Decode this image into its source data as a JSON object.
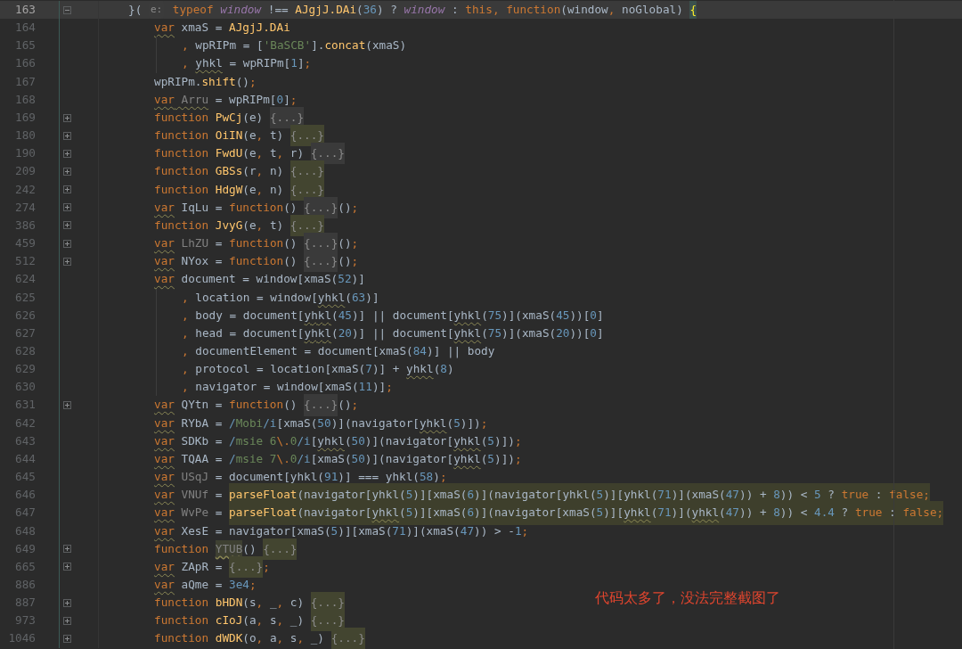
{
  "editor": {
    "lines": [
      {
        "number": "163",
        "kind": "header",
        "current": true,
        "fold": {
          "expanded": true
        },
        "tokens": [
          {
            "kind": "id",
            "text": "}( "
          },
          {
            "kind": "hint",
            "text": "e:"
          },
          {
            "kind": "kw",
            "text": " typeof "
          },
          {
            "kind": "param",
            "text": "window"
          },
          {
            "kind": "id",
            "text": " !== "
          },
          {
            "kind": "fn",
            "text": "AJgjJ.DAi"
          },
          {
            "kind": "id",
            "text": "("
          },
          {
            "kind": "num",
            "text": "36"
          },
          {
            "kind": "id",
            "text": ") ? "
          },
          {
            "kind": "param",
            "text": "window"
          },
          {
            "kind": "id",
            "text": " : "
          },
          {
            "kind": "kw",
            "text": "this"
          },
          {
            "kind": "punc",
            "text": ", "
          },
          {
            "kind": "kw",
            "text": "function"
          },
          {
            "kind": "id",
            "text": "(window"
          },
          {
            "kind": "punc",
            "text": ", "
          },
          {
            "kind": "id",
            "text": "noGlobal) "
          },
          {
            "kind": "brace",
            "text": "{"
          }
        ]
      },
      {
        "number": "164",
        "kind": "statement",
        "current": false,
        "tokens": [
          {
            "kind": "kwu",
            "text": "var"
          },
          {
            "kind": "id",
            "text": " xmaS = "
          },
          {
            "kind": "fn",
            "text": "AJgjJ.DAi"
          }
        ]
      },
      {
        "number": "165",
        "kind": "continuation",
        "current": false,
        "tokens": [
          {
            "kind": "punc",
            "text": ", "
          },
          {
            "kind": "id",
            "text": "wpRIPm = ["
          },
          {
            "kind": "str",
            "text": "'BaSCB'"
          },
          {
            "kind": "id",
            "text": "]."
          },
          {
            "kind": "fn",
            "text": "concat"
          },
          {
            "kind": "id",
            "text": "(xmaS)"
          }
        ]
      },
      {
        "number": "166",
        "kind": "continuation",
        "current": false,
        "tokens": [
          {
            "kind": "punc",
            "text": ", "
          },
          {
            "kind": "idu",
            "text": "yhkl"
          },
          {
            "kind": "id",
            "text": " = wpRIPm["
          },
          {
            "kind": "num",
            "text": "1"
          },
          {
            "kind": "id",
            "text": "]"
          },
          {
            "kind": "punc",
            "text": ";"
          }
        ]
      },
      {
        "number": "167",
        "kind": "statement",
        "current": false,
        "tokens": [
          {
            "kind": "id",
            "text": "wpRIPm."
          },
          {
            "kind": "fn",
            "text": "shift"
          },
          {
            "kind": "id",
            "text": "()"
          },
          {
            "kind": "punc",
            "text": ";"
          }
        ]
      },
      {
        "number": "168",
        "kind": "statement",
        "current": false,
        "tokens": [
          {
            "kind": "kwu",
            "text": "var"
          },
          {
            "kind": "dimu",
            "text": " Arru"
          },
          {
            "kind": "id",
            "text": " = wpRIPm["
          },
          {
            "kind": "num",
            "text": "0"
          },
          {
            "kind": "id",
            "text": "]"
          },
          {
            "kind": "punc",
            "text": ";"
          }
        ]
      },
      {
        "number": "169",
        "kind": "statement",
        "current": false,
        "fold": {
          "expanded": false
        },
        "tokens": [
          {
            "kind": "kw",
            "text": "function "
          },
          {
            "kind": "fn",
            "text": "PwCj"
          },
          {
            "kind": "id",
            "text": "(e) "
          },
          {
            "kind": "fold",
            "text": "{...}"
          }
        ]
      },
      {
        "number": "180",
        "kind": "statement",
        "current": false,
        "fold": {
          "expanded": false
        },
        "tokens": [
          {
            "kind": "kw",
            "text": "function "
          },
          {
            "kind": "fn",
            "text": "OiIN"
          },
          {
            "kind": "id",
            "text": "(e"
          },
          {
            "kind": "punc",
            "text": ", "
          },
          {
            "kind": "id",
            "text": "t) "
          },
          {
            "kind": "foldhl",
            "text": "{...}"
          }
        ]
      },
      {
        "number": "190",
        "kind": "statement",
        "current": false,
        "fold": {
          "expanded": false
        },
        "tokens": [
          {
            "kind": "kw",
            "text": "function "
          },
          {
            "kind": "fn",
            "text": "FwdU"
          },
          {
            "kind": "id",
            "text": "(e"
          },
          {
            "kind": "punc",
            "text": ", "
          },
          {
            "kind": "id",
            "text": "t"
          },
          {
            "kind": "punc",
            "text": ", "
          },
          {
            "kind": "id",
            "text": "r) "
          },
          {
            "kind": "fold",
            "text": "{...}"
          }
        ]
      },
      {
        "number": "209",
        "kind": "statement",
        "current": false,
        "fold": {
          "expanded": false
        },
        "tokens": [
          {
            "kind": "kw",
            "text": "function "
          },
          {
            "kind": "fn",
            "text": "GBSs"
          },
          {
            "kind": "id",
            "text": "(r"
          },
          {
            "kind": "punc",
            "text": ", "
          },
          {
            "kind": "id",
            "text": "n) "
          },
          {
            "kind": "foldhl",
            "text": "{...}"
          }
        ]
      },
      {
        "number": "242",
        "kind": "statement",
        "current": false,
        "fold": {
          "expanded": false
        },
        "tokens": [
          {
            "kind": "kw",
            "text": "function "
          },
          {
            "kind": "fn",
            "text": "HdgW"
          },
          {
            "kind": "id",
            "text": "(e"
          },
          {
            "kind": "punc",
            "text": ", "
          },
          {
            "kind": "id",
            "text": "n) "
          },
          {
            "kind": "foldhl",
            "text": "{...}"
          }
        ]
      },
      {
        "number": "274",
        "kind": "statement",
        "current": false,
        "fold": {
          "expanded": false
        },
        "tokens": [
          {
            "kind": "kwu",
            "text": "var"
          },
          {
            "kind": "id",
            "text": " IqLu = "
          },
          {
            "kind": "kw",
            "text": "function"
          },
          {
            "kind": "id",
            "text": "() "
          },
          {
            "kind": "fold",
            "text": "{...}"
          },
          {
            "kind": "id",
            "text": "()"
          },
          {
            "kind": "punc",
            "text": ";"
          }
        ]
      },
      {
        "number": "386",
        "kind": "statement",
        "current": false,
        "fold": {
          "expanded": false
        },
        "tokens": [
          {
            "kind": "kw",
            "text": "function "
          },
          {
            "kind": "fn",
            "text": "JvyG"
          },
          {
            "kind": "id",
            "text": "(e"
          },
          {
            "kind": "punc",
            "text": ", "
          },
          {
            "kind": "id",
            "text": "t) "
          },
          {
            "kind": "foldhl",
            "text": "{...}"
          }
        ]
      },
      {
        "number": "459",
        "kind": "statement",
        "current": false,
        "fold": {
          "expanded": false
        },
        "tokens": [
          {
            "kind": "kwu",
            "text": "var"
          },
          {
            "kind": "dim",
            "text": " LhZU"
          },
          {
            "kind": "id",
            "text": " = "
          },
          {
            "kind": "kw",
            "text": "function"
          },
          {
            "kind": "id",
            "text": "() "
          },
          {
            "kind": "fold",
            "text": "{...}"
          },
          {
            "kind": "id",
            "text": "()"
          },
          {
            "kind": "punc",
            "text": ";"
          }
        ]
      },
      {
        "number": "512",
        "kind": "statement",
        "current": false,
        "fold": {
          "expanded": false
        },
        "tokens": [
          {
            "kind": "kwu",
            "text": "var"
          },
          {
            "kind": "id",
            "text": " NYox = "
          },
          {
            "kind": "kw",
            "text": "function"
          },
          {
            "kind": "id",
            "text": "() "
          },
          {
            "kind": "fold",
            "text": "{...}"
          },
          {
            "kind": "id",
            "text": "()"
          },
          {
            "kind": "punc",
            "text": ";"
          }
        ]
      },
      {
        "number": "624",
        "kind": "statement",
        "current": false,
        "tokens": [
          {
            "kind": "kwu",
            "text": "var"
          },
          {
            "kind": "id",
            "text": " document = window[xmaS("
          },
          {
            "kind": "num",
            "text": "52"
          },
          {
            "kind": "id",
            "text": ")]"
          }
        ]
      },
      {
        "number": "625",
        "kind": "continuation",
        "current": false,
        "tokens": [
          {
            "kind": "punc",
            "text": ", "
          },
          {
            "kind": "id",
            "text": "location = window["
          },
          {
            "kind": "idu",
            "text": "yhkl"
          },
          {
            "kind": "id",
            "text": "("
          },
          {
            "kind": "num",
            "text": "63"
          },
          {
            "kind": "id",
            "text": ")]"
          }
        ]
      },
      {
        "number": "626",
        "kind": "continuation",
        "current": false,
        "tokens": [
          {
            "kind": "punc",
            "text": ", "
          },
          {
            "kind": "id",
            "text": "body = document["
          },
          {
            "kind": "idu",
            "text": "yhkl"
          },
          {
            "kind": "id",
            "text": "("
          },
          {
            "kind": "num",
            "text": "45"
          },
          {
            "kind": "id",
            "text": ")] || document["
          },
          {
            "kind": "idu",
            "text": "yhkl"
          },
          {
            "kind": "id",
            "text": "("
          },
          {
            "kind": "num",
            "text": "75"
          },
          {
            "kind": "id",
            "text": ")](xmaS("
          },
          {
            "kind": "num",
            "text": "45"
          },
          {
            "kind": "id",
            "text": "))["
          },
          {
            "kind": "num",
            "text": "0"
          },
          {
            "kind": "id",
            "text": "]"
          }
        ]
      },
      {
        "number": "627",
        "kind": "continuation",
        "current": false,
        "tokens": [
          {
            "kind": "punc",
            "text": ", "
          },
          {
            "kind": "id",
            "text": "head = document["
          },
          {
            "kind": "idu",
            "text": "yhkl"
          },
          {
            "kind": "id",
            "text": "("
          },
          {
            "kind": "num",
            "text": "20"
          },
          {
            "kind": "id",
            "text": ")] || document["
          },
          {
            "kind": "idu",
            "text": "yhkl"
          },
          {
            "kind": "id",
            "text": "("
          },
          {
            "kind": "num",
            "text": "75"
          },
          {
            "kind": "id",
            "text": ")](xmaS("
          },
          {
            "kind": "num",
            "text": "20"
          },
          {
            "kind": "id",
            "text": "))["
          },
          {
            "kind": "num",
            "text": "0"
          },
          {
            "kind": "id",
            "text": "]"
          }
        ]
      },
      {
        "number": "628",
        "kind": "continuation",
        "current": false,
        "tokens": [
          {
            "kind": "punc",
            "text": ", "
          },
          {
            "kind": "id",
            "text": "documentElement = document[xmaS("
          },
          {
            "kind": "num",
            "text": "84"
          },
          {
            "kind": "id",
            "text": ")] || body"
          }
        ]
      },
      {
        "number": "629",
        "kind": "continuation",
        "current": false,
        "tokens": [
          {
            "kind": "punc",
            "text": ", "
          },
          {
            "kind": "id",
            "text": "protocol = location[xmaS("
          },
          {
            "kind": "num",
            "text": "7"
          },
          {
            "kind": "id",
            "text": ")] + "
          },
          {
            "kind": "idu",
            "text": "yhkl"
          },
          {
            "kind": "id",
            "text": "("
          },
          {
            "kind": "num",
            "text": "8"
          },
          {
            "kind": "id",
            "text": ")"
          }
        ]
      },
      {
        "number": "630",
        "kind": "continuation",
        "current": false,
        "tokens": [
          {
            "kind": "punc",
            "text": ", "
          },
          {
            "kind": "id",
            "text": "navigator = window[xmaS("
          },
          {
            "kind": "num",
            "text": "11"
          },
          {
            "kind": "id",
            "text": ")]"
          },
          {
            "kind": "punc",
            "text": ";"
          }
        ]
      },
      {
        "number": "631",
        "kind": "statement",
        "current": false,
        "fold": {
          "expanded": false
        },
        "tokens": [
          {
            "kind": "kwu",
            "text": "var"
          },
          {
            "kind": "id",
            "text": " QYtn = "
          },
          {
            "kind": "kw",
            "text": "function"
          },
          {
            "kind": "id",
            "text": "() "
          },
          {
            "kind": "fold",
            "text": "{...}"
          },
          {
            "kind": "id",
            "text": "()"
          },
          {
            "kind": "punc",
            "text": ";"
          }
        ]
      },
      {
        "number": "642",
        "kind": "statement",
        "current": false,
        "tokens": [
          {
            "kind": "kwu",
            "text": "var"
          },
          {
            "kind": "id",
            "text": " RYbA = "
          },
          {
            "kind": "rxd",
            "text": "/"
          },
          {
            "kind": "rx",
            "text": "Mobi"
          },
          {
            "kind": "rxd",
            "text": "/i"
          },
          {
            "kind": "id",
            "text": "[xmaS("
          },
          {
            "kind": "num",
            "text": "50"
          },
          {
            "kind": "id",
            "text": ")](navigator["
          },
          {
            "kind": "idu",
            "text": "yhkl"
          },
          {
            "kind": "id",
            "text": "("
          },
          {
            "kind": "num",
            "text": "5"
          },
          {
            "kind": "id",
            "text": ")])"
          },
          {
            "kind": "punc",
            "text": ";"
          }
        ]
      },
      {
        "number": "643",
        "kind": "statement",
        "current": false,
        "tokens": [
          {
            "kind": "kwu",
            "text": "var"
          },
          {
            "kind": "id",
            "text": " SDKb = "
          },
          {
            "kind": "rxd",
            "text": "/"
          },
          {
            "kind": "rx",
            "text": "msie 6"
          },
          {
            "kind": "esc",
            "text": "\\."
          },
          {
            "kind": "rx",
            "text": "0"
          },
          {
            "kind": "rxd",
            "text": "/i"
          },
          {
            "kind": "id",
            "text": "["
          },
          {
            "kind": "idu",
            "text": "yhkl"
          },
          {
            "kind": "id",
            "text": "("
          },
          {
            "kind": "num",
            "text": "50"
          },
          {
            "kind": "id",
            "text": ")](navigator["
          },
          {
            "kind": "idu",
            "text": "yhkl"
          },
          {
            "kind": "id",
            "text": "("
          },
          {
            "kind": "num",
            "text": "5"
          },
          {
            "kind": "id",
            "text": ")])"
          },
          {
            "kind": "punc",
            "text": ";"
          }
        ]
      },
      {
        "number": "644",
        "kind": "statement",
        "current": false,
        "tokens": [
          {
            "kind": "kwu",
            "text": "var"
          },
          {
            "kind": "id",
            "text": " TQAA = "
          },
          {
            "kind": "rxd",
            "text": "/"
          },
          {
            "kind": "rx",
            "text": "msie 7"
          },
          {
            "kind": "esc",
            "text": "\\."
          },
          {
            "kind": "rx",
            "text": "0"
          },
          {
            "kind": "rxd",
            "text": "/i"
          },
          {
            "kind": "id",
            "text": "[xmaS("
          },
          {
            "kind": "num",
            "text": "50"
          },
          {
            "kind": "id",
            "text": ")](navigator["
          },
          {
            "kind": "idu",
            "text": "yhkl"
          },
          {
            "kind": "id",
            "text": "("
          },
          {
            "kind": "num",
            "text": "5"
          },
          {
            "kind": "id",
            "text": ")])"
          },
          {
            "kind": "punc",
            "text": ";"
          }
        ]
      },
      {
        "number": "645",
        "kind": "statement",
        "current": false,
        "tokens": [
          {
            "kind": "kwu",
            "text": "var"
          },
          {
            "kind": "dim",
            "text": " USqJ"
          },
          {
            "kind": "id",
            "text": " = document["
          },
          {
            "kind": "idu",
            "text": "yhkl"
          },
          {
            "kind": "id",
            "text": "("
          },
          {
            "kind": "num",
            "text": "91"
          },
          {
            "kind": "id",
            "text": ")] === "
          },
          {
            "kind": "idu",
            "text": "yhkl"
          },
          {
            "kind": "id",
            "text": "("
          },
          {
            "kind": "num",
            "text": "58"
          },
          {
            "kind": "id",
            "text": ")"
          },
          {
            "kind": "punc",
            "text": ";"
          }
        ]
      },
      {
        "number": "646",
        "kind": "statement",
        "current": false,
        "tokens": [
          {
            "kind": "kwu",
            "text": "var"
          },
          {
            "kind": "dim",
            "text": " VNUf"
          },
          {
            "kind": "id",
            "text": " = "
          }
        ],
        "highlighted": [
          {
            "kind": "fn",
            "text": "parseFloat"
          },
          {
            "kind": "id",
            "text": "(navigator["
          },
          {
            "kind": "idu",
            "text": "yhkl"
          },
          {
            "kind": "id",
            "text": "("
          },
          {
            "kind": "num",
            "text": "5"
          },
          {
            "kind": "id",
            "text": ")][xmaS("
          },
          {
            "kind": "num",
            "text": "6"
          },
          {
            "kind": "id",
            "text": ")](navigator["
          },
          {
            "kind": "idu",
            "text": "yhkl"
          },
          {
            "kind": "id",
            "text": "("
          },
          {
            "kind": "num",
            "text": "5"
          },
          {
            "kind": "id",
            "text": ")]["
          },
          {
            "kind": "idu",
            "text": "yhkl"
          },
          {
            "kind": "id",
            "text": "("
          },
          {
            "kind": "num",
            "text": "71"
          },
          {
            "kind": "id",
            "text": ")](xmaS("
          },
          {
            "kind": "num",
            "text": "47"
          },
          {
            "kind": "id",
            "text": ")) + "
          },
          {
            "kind": "num",
            "text": "8"
          },
          {
            "kind": "id",
            "text": ")) < "
          },
          {
            "kind": "num",
            "text": "5"
          },
          {
            "kind": "id",
            "text": " ? "
          },
          {
            "kind": "kw",
            "text": "true"
          },
          {
            "kind": "id",
            "text": " : "
          },
          {
            "kind": "kw",
            "text": "false"
          },
          {
            "kind": "punc",
            "text": ";"
          }
        ]
      },
      {
        "number": "647",
        "kind": "statement",
        "current": false,
        "tokens": [
          {
            "kind": "kwu",
            "text": "var"
          },
          {
            "kind": "dim",
            "text": " WvPe"
          },
          {
            "kind": "id",
            "text": " = "
          }
        ],
        "highlighted": [
          {
            "kind": "fn",
            "text": "parseFloat"
          },
          {
            "kind": "id",
            "text": "(navigator["
          },
          {
            "kind": "idu",
            "text": "yhkl"
          },
          {
            "kind": "id",
            "text": "("
          },
          {
            "kind": "num",
            "text": "5"
          },
          {
            "kind": "id",
            "text": ")][xmaS("
          },
          {
            "kind": "num",
            "text": "6"
          },
          {
            "kind": "id",
            "text": ")](navigator[xmaS("
          },
          {
            "kind": "num",
            "text": "5"
          },
          {
            "kind": "id",
            "text": ")]["
          },
          {
            "kind": "idu",
            "text": "yhkl"
          },
          {
            "kind": "id",
            "text": "("
          },
          {
            "kind": "num",
            "text": "71"
          },
          {
            "kind": "id",
            "text": ")]("
          },
          {
            "kind": "idu",
            "text": "yhkl"
          },
          {
            "kind": "id",
            "text": "("
          },
          {
            "kind": "num",
            "text": "47"
          },
          {
            "kind": "id",
            "text": ")) + "
          },
          {
            "kind": "num",
            "text": "8"
          },
          {
            "kind": "id",
            "text": ")) < "
          },
          {
            "kind": "num",
            "text": "4.4"
          },
          {
            "kind": "id",
            "text": " ? "
          },
          {
            "kind": "kw",
            "text": "true"
          },
          {
            "kind": "id",
            "text": " : "
          },
          {
            "kind": "kw",
            "text": "false"
          },
          {
            "kind": "punc",
            "text": ";"
          }
        ]
      },
      {
        "number": "648",
        "kind": "statement",
        "current": false,
        "tokens": [
          {
            "kind": "kwu",
            "text": "var"
          },
          {
            "kind": "id",
            "text": " XesE = navigator[xmaS("
          },
          {
            "kind": "num",
            "text": "5"
          },
          {
            "kind": "id",
            "text": ")][xmaS("
          },
          {
            "kind": "num",
            "text": "71"
          },
          {
            "kind": "id",
            "text": ")](xmaS("
          },
          {
            "kind": "num",
            "text": "47"
          },
          {
            "kind": "id",
            "text": ")) > -"
          },
          {
            "kind": "num",
            "text": "1"
          },
          {
            "kind": "punc",
            "text": ";"
          }
        ]
      },
      {
        "number": "649",
        "kind": "statement",
        "current": false,
        "fold": {
          "expanded": false
        },
        "tokens": [
          {
            "kind": "kw",
            "text": "function "
          },
          {
            "kind": "usage",
            "text": "YTUB"
          },
          {
            "kind": "id",
            "text": "() "
          },
          {
            "kind": "foldhl",
            "text": "{...}"
          }
        ]
      },
      {
        "number": "665",
        "kind": "statement",
        "current": false,
        "fold": {
          "expanded": false
        },
        "tokens": [
          {
            "kind": "kwu",
            "text": "var"
          },
          {
            "kind": "id",
            "text": " ZApR = "
          },
          {
            "kind": "foldhl",
            "text": "{...}"
          },
          {
            "kind": "punc",
            "text": ";"
          }
        ]
      },
      {
        "number": "886",
        "kind": "statement",
        "current": false,
        "tokens": [
          {
            "kind": "kwu",
            "text": "var"
          },
          {
            "kind": "id",
            "text": " aQme = "
          },
          {
            "kind": "num",
            "text": "3e4"
          },
          {
            "kind": "punc",
            "text": ";"
          }
        ]
      },
      {
        "number": "887",
        "kind": "statement",
        "current": false,
        "fold": {
          "expanded": false
        },
        "tokens": [
          {
            "kind": "kw",
            "text": "function "
          },
          {
            "kind": "fn",
            "text": "bHDN"
          },
          {
            "kind": "id",
            "text": "(s"
          },
          {
            "kind": "punc",
            "text": ", "
          },
          {
            "kind": "id",
            "text": "_"
          },
          {
            "kind": "punc",
            "text": ", "
          },
          {
            "kind": "id",
            "text": "c) "
          },
          {
            "kind": "foldhl",
            "text": "{...}"
          }
        ]
      },
      {
        "number": "973",
        "kind": "statement",
        "current": false,
        "fold": {
          "expanded": false
        },
        "tokens": [
          {
            "kind": "kw",
            "text": "function "
          },
          {
            "kind": "fn",
            "text": "cIoJ"
          },
          {
            "kind": "id",
            "text": "(a"
          },
          {
            "kind": "punc",
            "text": ", "
          },
          {
            "kind": "id",
            "text": "s"
          },
          {
            "kind": "punc",
            "text": ", "
          },
          {
            "kind": "id",
            "text": "_) "
          },
          {
            "kind": "foldhl",
            "text": "{...}"
          }
        ]
      },
      {
        "number": "1046",
        "kind": "statement",
        "current": false,
        "fold": {
          "expanded": false
        },
        "tokens": [
          {
            "kind": "kw",
            "text": "function "
          },
          {
            "kind": "fn",
            "text": "dWDK"
          },
          {
            "kind": "id",
            "text": "(o"
          },
          {
            "kind": "punc",
            "text": ", "
          },
          {
            "kind": "id",
            "text": "a"
          },
          {
            "kind": "punc",
            "text": ", "
          },
          {
            "kind": "id",
            "text": "s"
          },
          {
            "kind": "punc",
            "text": ", "
          },
          {
            "kind": "id",
            "text": "_) "
          },
          {
            "kind": "foldhl",
            "text": "{...}"
          }
        ]
      }
    ]
  },
  "annotation": "代码太多了，没法完整截图了"
}
